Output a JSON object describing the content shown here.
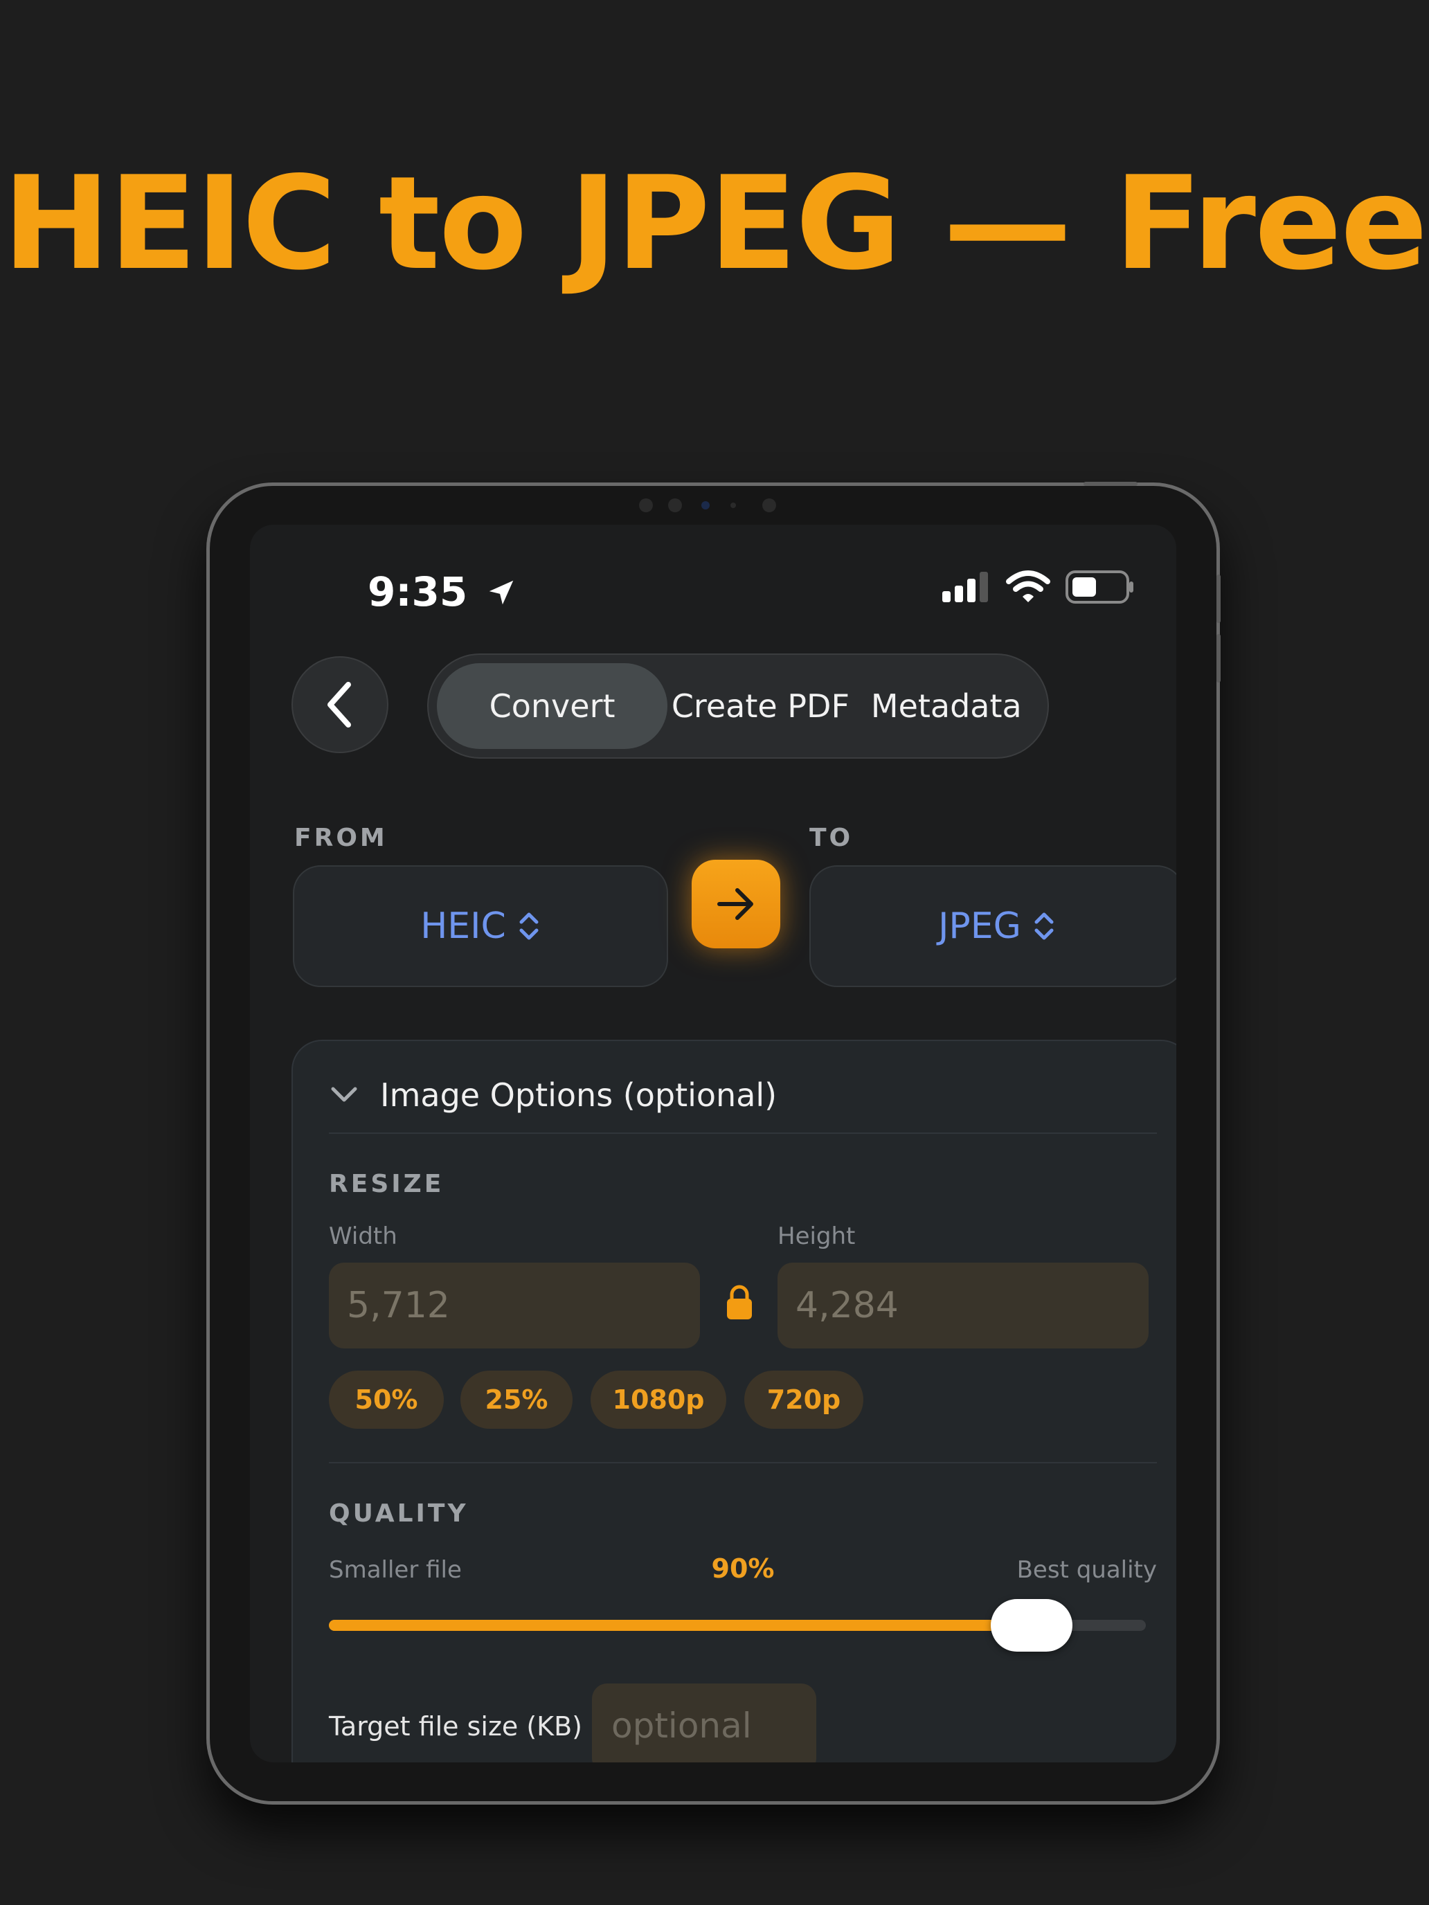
{
  "headline": "HEIC to JPEG — Free",
  "status_bar": {
    "time": "9:35",
    "icons": [
      "location-arrow-icon",
      "cellular-signal-icon",
      "wifi-icon",
      "battery-icon"
    ]
  },
  "nav": {
    "back_icon": "chevron-left-icon",
    "tabs": [
      {
        "label": "Convert",
        "active": true
      },
      {
        "label": "Create PDF",
        "active": false
      },
      {
        "label": "Metadata",
        "active": false
      }
    ]
  },
  "conversion": {
    "from_label": "FROM",
    "to_label": "TO",
    "from_value": "HEIC",
    "to_value": "JPEG",
    "swap_icon": "arrow-right-icon"
  },
  "options": {
    "header": "Image Options (optional)",
    "expanded": true,
    "resize": {
      "title": "RESIZE",
      "width_label": "Width",
      "height_label": "Height",
      "width_placeholder": "5,712",
      "height_placeholder": "4,284",
      "lock_icon": "lock-icon",
      "presets": [
        "50%",
        "25%",
        "1080p",
        "720p"
      ]
    },
    "quality": {
      "title": "QUALITY",
      "min_label": "Smaller file",
      "max_label": "Best quality",
      "value_label": "90%",
      "value": 0.9
    },
    "target_size": {
      "label": "Target file size (KB)",
      "placeholder": "optional"
    }
  },
  "colors": {
    "accent": "#f5a012",
    "format_text": "#6f95ee",
    "background": "#1e1e1e"
  }
}
